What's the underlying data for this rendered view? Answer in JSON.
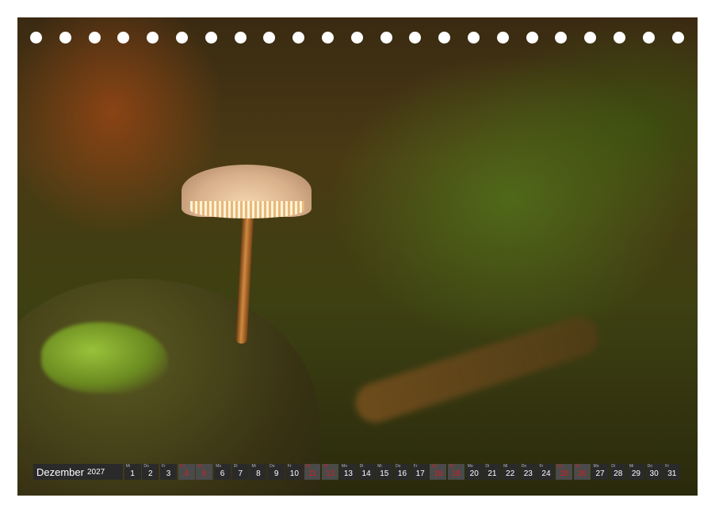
{
  "calendar": {
    "month": "Dezember",
    "year": "2027",
    "days": [
      {
        "wd": "Mi",
        "num": "1",
        "weekend": false
      },
      {
        "wd": "Do",
        "num": "2",
        "weekend": false
      },
      {
        "wd": "Fr",
        "num": "3",
        "weekend": false
      },
      {
        "wd": "Sa",
        "num": "4",
        "weekend": true
      },
      {
        "wd": "So",
        "num": "5",
        "weekend": true
      },
      {
        "wd": "Mo",
        "num": "6",
        "weekend": false
      },
      {
        "wd": "Di",
        "num": "7",
        "weekend": false
      },
      {
        "wd": "Mi",
        "num": "8",
        "weekend": false
      },
      {
        "wd": "Do",
        "num": "9",
        "weekend": false
      },
      {
        "wd": "Fr",
        "num": "10",
        "weekend": false
      },
      {
        "wd": "Sa",
        "num": "11",
        "weekend": true
      },
      {
        "wd": "So",
        "num": "12",
        "weekend": true
      },
      {
        "wd": "Mo",
        "num": "13",
        "weekend": false
      },
      {
        "wd": "Di",
        "num": "14",
        "weekend": false
      },
      {
        "wd": "Mi",
        "num": "15",
        "weekend": false
      },
      {
        "wd": "Do",
        "num": "16",
        "weekend": false
      },
      {
        "wd": "Fr",
        "num": "17",
        "weekend": false
      },
      {
        "wd": "Sa",
        "num": "18",
        "weekend": true
      },
      {
        "wd": "So",
        "num": "19",
        "weekend": true
      },
      {
        "wd": "Mo",
        "num": "20",
        "weekend": false
      },
      {
        "wd": "Di",
        "num": "21",
        "weekend": false
      },
      {
        "wd": "Mi",
        "num": "22",
        "weekend": false
      },
      {
        "wd": "Do",
        "num": "23",
        "weekend": false
      },
      {
        "wd": "Fr",
        "num": "24",
        "weekend": false
      },
      {
        "wd": "Sa",
        "num": "25",
        "weekend": true
      },
      {
        "wd": "So",
        "num": "26",
        "weekend": true
      },
      {
        "wd": "Mo",
        "num": "27",
        "weekend": false
      },
      {
        "wd": "Di",
        "num": "28",
        "weekend": false
      },
      {
        "wd": "Mi",
        "num": "29",
        "weekend": false
      },
      {
        "wd": "Do",
        "num": "30",
        "weekend": false
      },
      {
        "wd": "Fr",
        "num": "31",
        "weekend": false
      }
    ]
  },
  "colors": {
    "bar": "#2a2a2a",
    "weekend_text": "#d02020",
    "holes": "#ffffff"
  },
  "binding_holes": 23
}
